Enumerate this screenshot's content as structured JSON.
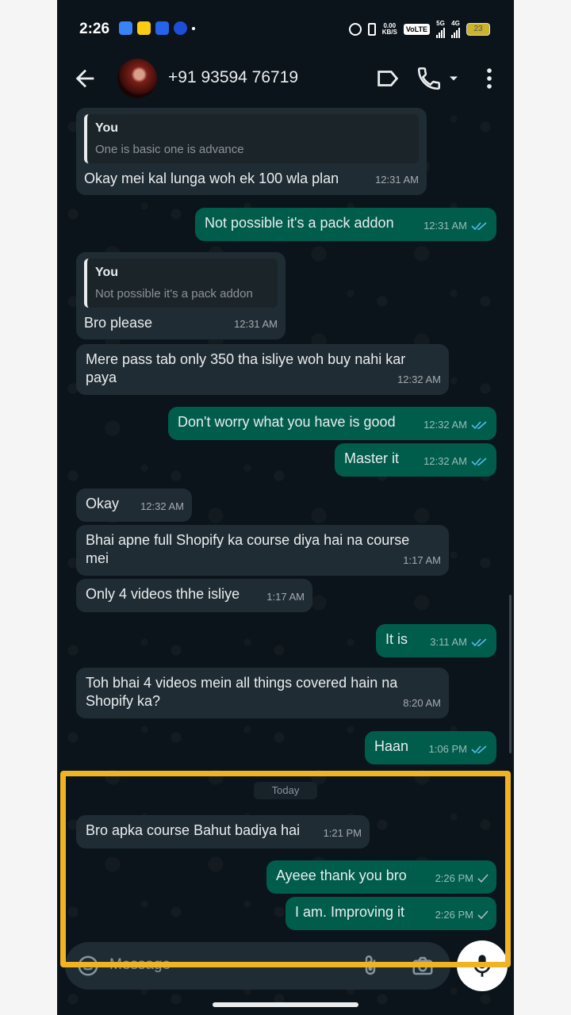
{
  "status_bar": {
    "time": "2:26",
    "net_speed_top": "0.00",
    "net_speed_bottom": "KB/S",
    "volte": "VoLTE",
    "sim1": "5G",
    "sim2": "4G",
    "battery": "23"
  },
  "header": {
    "contact_name": "+91 93594 76719"
  },
  "messages": [
    {
      "dir": "in",
      "quote_name": "You",
      "quote_text": "One is basic one is advance",
      "text": "Okay mei kal lunga woh ek  100 wla plan",
      "time": "12:31 AM"
    },
    {
      "dir": "out",
      "text": "Not possible it's a pack addon",
      "time": "12:31 AM",
      "status": "read"
    },
    {
      "dir": "in",
      "quote_name": "You",
      "quote_text": "Not possible it's a pack addon",
      "text": "Bro please",
      "time": "12:31 AM"
    },
    {
      "dir": "in",
      "text": "Mere pass tab only 350 tha isliye woh buy nahi kar paya",
      "time": "12:32 AM"
    },
    {
      "dir": "out",
      "text": "Don't worry what you have is good",
      "time": "12:32 AM",
      "status": "read"
    },
    {
      "dir": "out",
      "text": "Master it",
      "time": "12:32 AM",
      "status": "read"
    },
    {
      "dir": "in",
      "text": "Okay",
      "time": "12:32 AM"
    },
    {
      "dir": "in",
      "text": "Bhai apne full Shopify ka course diya hai na course mei",
      "time": "1:17 AM"
    },
    {
      "dir": "in",
      "text": "Only 4 videos thhe isliye",
      "time": "1:17 AM"
    },
    {
      "dir": "out",
      "text": "It is",
      "time": "3:11 AM",
      "status": "read"
    },
    {
      "dir": "in",
      "text": "Toh bhai 4 videos mein all things covered hain na Shopify ka?",
      "time": "8:20 AM"
    },
    {
      "dir": "out",
      "text": "Haan",
      "time": "1:06 PM",
      "status": "read"
    },
    {
      "dir": "in",
      "text": "Bro apka course Bahut badiya hai",
      "time": "1:21 PM"
    },
    {
      "dir": "out",
      "text": "Ayeee thank you bro",
      "time": "2:26 PM",
      "status": "sent"
    },
    {
      "dir": "out",
      "text": "I am. Improving it",
      "time": "2:26 PM",
      "status": "sent"
    }
  ],
  "date_divider": "Today",
  "composer": {
    "placeholder": "Message"
  },
  "colors": {
    "background": "#0b141a",
    "incoming_bubble": "#202c33",
    "outgoing_bubble": "#005c4b",
    "read_tick": "#53bdeb",
    "highlight_box": "#f0b323"
  },
  "icons": [
    "back-arrow-icon",
    "label-icon",
    "phone-call-icon",
    "chevron-down-icon",
    "more-vert-icon",
    "emoji-icon",
    "attach-icon",
    "camera-icon",
    "mic-icon",
    "double-tick-icon",
    "single-tick-icon"
  ]
}
